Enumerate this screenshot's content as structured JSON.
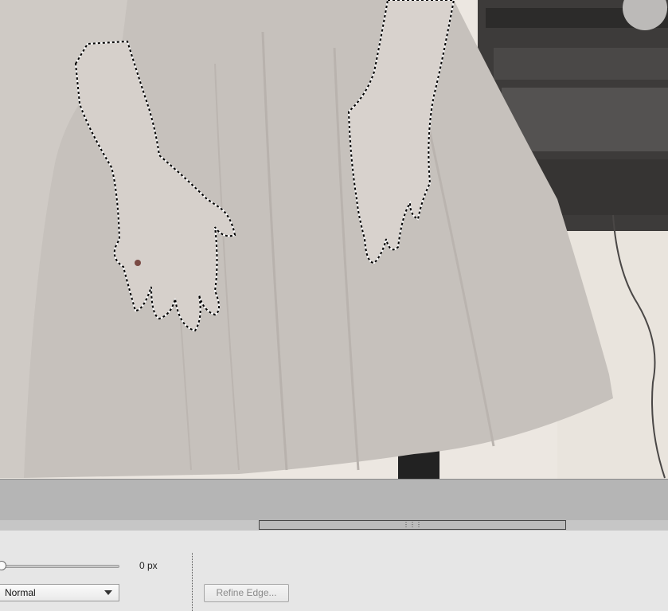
{
  "image_canvas": {
    "description_icon": "photo-canvas"
  },
  "scrollbar": {
    "grip_icon": "grip-lines-icon"
  },
  "options": {
    "feather_value": "0 px",
    "mode": {
      "selected": "Normal"
    },
    "refine_edge_label": "Refine Edge..."
  },
  "colors": {
    "canvas_bg": "#ede8e2",
    "dress": "#c2bdb9",
    "panel": "#e6e6e6",
    "strip": "#b5b5b5"
  }
}
